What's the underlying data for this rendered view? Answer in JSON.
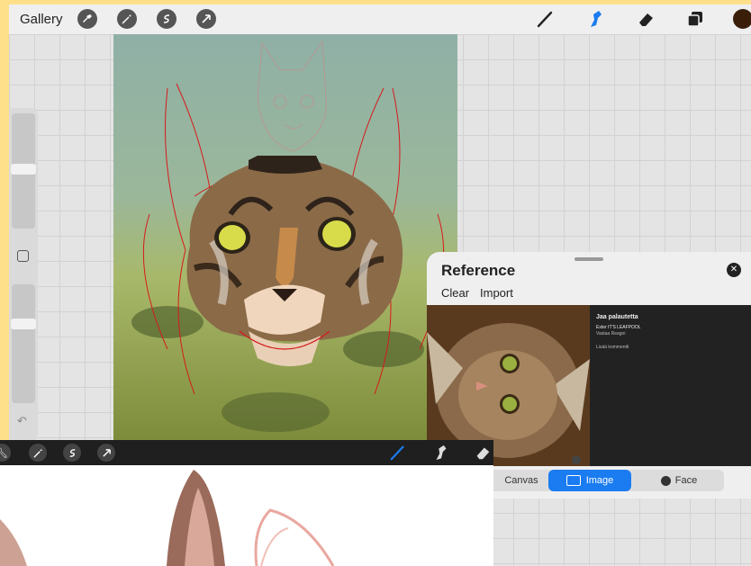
{
  "toolbar": {
    "gallery_label": "Gallery",
    "left_tools": [
      "wrench-icon",
      "magic-wand-icon",
      "selection-icon",
      "move-arrow-icon"
    ],
    "right_tools": [
      "brush-icon",
      "smudge-icon",
      "eraser-icon",
      "layers-icon"
    ],
    "active_tool": "smudge-icon",
    "active_color": "#3a1e0a",
    "accent_color": "#1a7cf0"
  },
  "reference": {
    "title": "Reference",
    "clear_label": "Clear",
    "import_label": "Import",
    "segments": [
      "Canvas",
      "Image",
      "Face"
    ],
    "active_segment": "Image",
    "meta": {
      "title": "Jaa palautetta",
      "line1": "Exter IT'S LEAFPOOL",
      "line2": "Vastaa  Reagoi",
      "comment": "Lisää kommentti"
    }
  }
}
